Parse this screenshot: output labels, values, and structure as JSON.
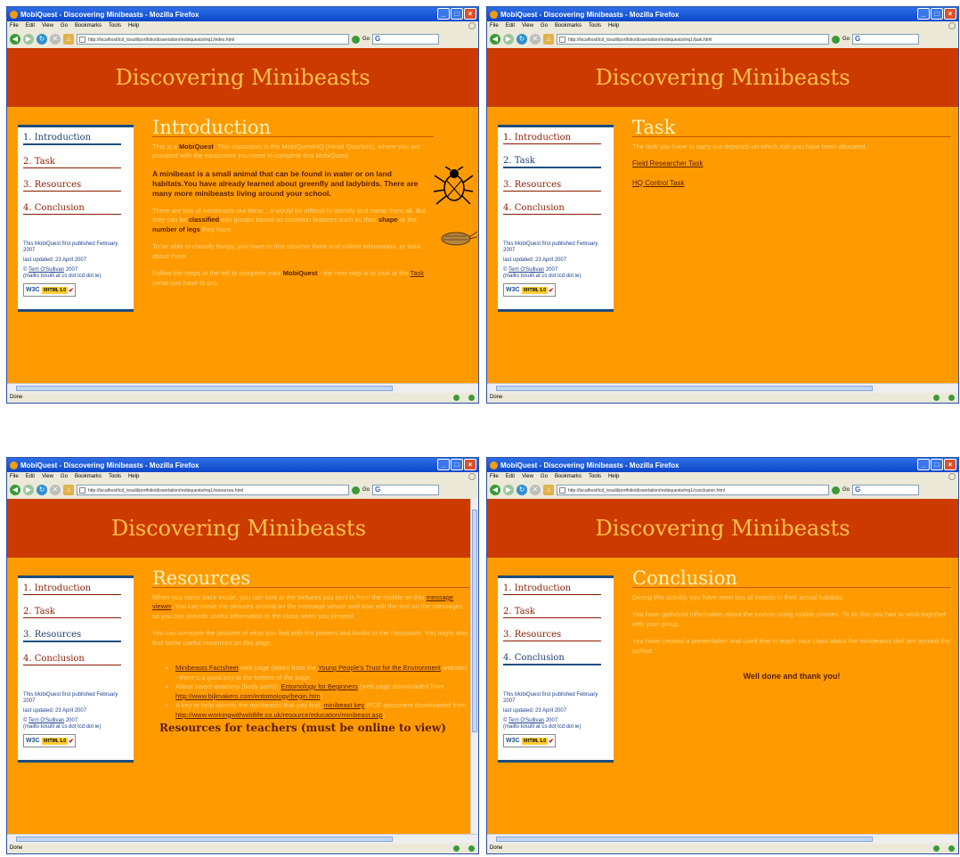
{
  "browser": {
    "title": "MobiQuest - Discovering Minibeasts - Mozilla Firefox",
    "menu": [
      "File",
      "Edit",
      "View",
      "Go",
      "Bookmarks",
      "Tools",
      "Help"
    ],
    "go_label": "Go",
    "status": "Done"
  },
  "site": {
    "header": "Discovering Minibeasts",
    "nav": [
      "1. Introduction",
      "2. Task",
      "3. Resources",
      "4. Conclusion"
    ],
    "meta": {
      "published": "This MobiQuest first published February 2007",
      "updated": "last updated: 23 April 2007",
      "copyright_prefix": "©",
      "author": "Terri O'Sullivan",
      "year": "2007",
      "email": "(mailto tosulli at cs dot tcd dot ie)"
    },
    "badge": {
      "w3c": "W3C",
      "xhtml": "XHTML 1.0"
    }
  },
  "windows": {
    "intro": {
      "url": "http://localhost/tcd_tosulli/portfolio/dissertation/mobiquests/mq1/index.html",
      "heading": "Introduction",
      "p1_a": "This is a ",
      "p1_b": "MobiQuest",
      "p1_c": ". This classroom is the MobiQuestHQ (Head Quarters), where you are provided with the equipment you need to complete this MobiQuest.",
      "p2": "A minibeast is a small animal that can be found in water or on land habitats.You have already learned about greenfly and ladybirds. There are many more minibeasts living around your school.",
      "p3_a": "There are lots of minibeasts out there....it would be difficult to identify and name them all. But they can be ",
      "p3_b": "classified",
      "p3_c": " into groups based on common features such as their ",
      "p3_d": "shape",
      "p3_e": " or the ",
      "p3_f": "number of legs",
      "p3_g": " they have.",
      "p4": "To be able to classify things, you have to first observe them and collect information, or data, about them.",
      "p5_a": "Follow the steps at the left to complete your ",
      "p5_b": "MobiQuest",
      "p5_c": " - the next step is to look at the ",
      "p5_d": "Task",
      "p5_e": " (what you have to do)."
    },
    "task": {
      "url": "http://localhost/tcd_tosulli/portfolio/dissertation/mobiquests/mq1/task.html",
      "heading": "Task",
      "p1": "The task you have to carry out depends on which role you have been allocated.",
      "link1": "Field Researcher Task",
      "link2": "HQ Control Task"
    },
    "resources": {
      "url": "http://localhost/tcd_tosulli/portfolio/dissertation/mobiquests/mq1/resources.html",
      "heading": "Resources",
      "p1_a": "When you come back inside, you can look at the pictures you sent in from the mobile on this ",
      "p1_b": "message viewer",
      "p1_c": ". You can move the pictures around on the message viewer and also edit the text on the messages so you can provide useful information to the class when you present.",
      "p2": "You can compare the pictures of what you find with the posters and books in the classroom. You might also find some useful resources on this page.",
      "b1_a": "Minibeasts Factsheet",
      "b1_b": " web page (taken from the ",
      "b1_c": "Young People's Trust for the Environment",
      "b1_d": " website) - there's a good key at the bottom of the page.",
      "b2_a": "About insect anatomy (body parts): ",
      "b2_b": "Entomology for Beginners",
      "b2_c": " (web page downloaded from ",
      "b2_d": "http://www.bijlmakers.com/entomology/begin.htm",
      "b2_e": ")",
      "b3_a": "A key to help identify the minibeasts that you find: ",
      "b3_b": "minibeast key",
      "b3_c": " (PDF document downloaded from ",
      "b3_d": "http://www.workingwithwildlife.co.uk/resource/education/minibeast.asp",
      "b3_e": ")",
      "h2": "Resources for teachers (must be online to view)"
    },
    "conclusion": {
      "url": "http://localhost/tcd_tosulli/portfolio/dissertation/mobiquests/mq1/conclusion.html",
      "heading": "Conclusion",
      "p1": "During this activity, you have seen lots of insects in their actual habitats.",
      "p2": "You have gathered information about the insects using mobile phones. To do this you had to work together with your group.",
      "p3": "You have created a presentation and used that to teach your class about the minibeasts that are around the school.",
      "closing": "Well done and thank you!"
    }
  },
  "colors": {
    "page_bg": "#ff9b00",
    "header_bg": "#cc3a00",
    "header_text": "#ffc34a",
    "body_text": "#ffd27a",
    "strong_text": "#5a1e00"
  }
}
